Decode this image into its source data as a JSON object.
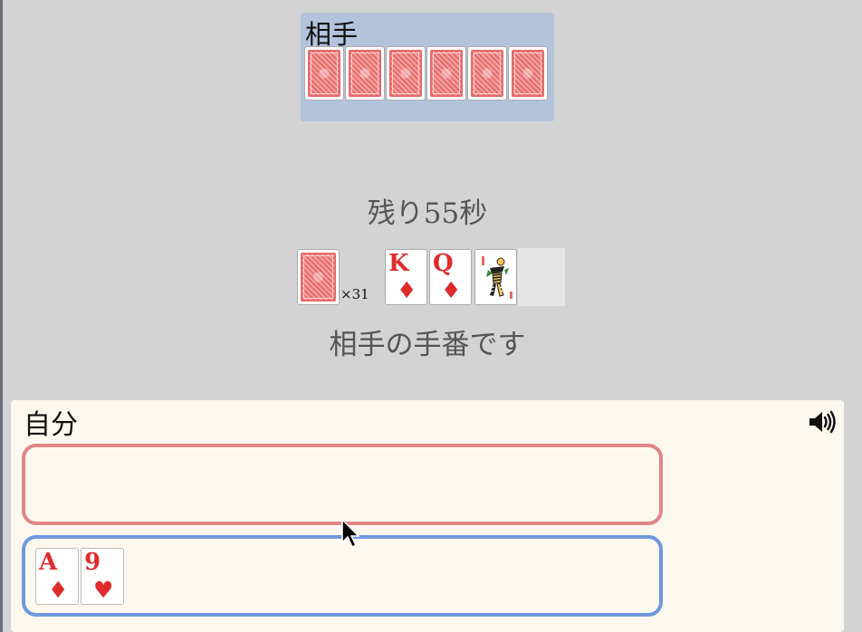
{
  "opponent": {
    "label": "相手",
    "hand_count": 6
  },
  "timer_text": "残り55秒",
  "deck": {
    "count_text": "×31"
  },
  "table_cards": [
    {
      "rank": "K",
      "suit": "♦"
    },
    {
      "rank": "Q",
      "suit": "♦"
    },
    {
      "rank": "Joker",
      "suit": ""
    }
  ],
  "status_text": "相手の手番です",
  "player": {
    "label": "自分",
    "sound_icon": "speaker-volume-icon",
    "hand": [
      {
        "rank": "A",
        "suit": "♦"
      },
      {
        "rank": "9",
        "suit": "♥"
      }
    ]
  },
  "colors": {
    "background": "#d3d3d3",
    "opponent_panel": "#b3c3dc",
    "player_panel": "#fdf8ef",
    "discard_border": "#e08585",
    "hand_border": "#6f97e1",
    "red_suit": "#e02b2b",
    "card_back": "#e86a6a"
  }
}
